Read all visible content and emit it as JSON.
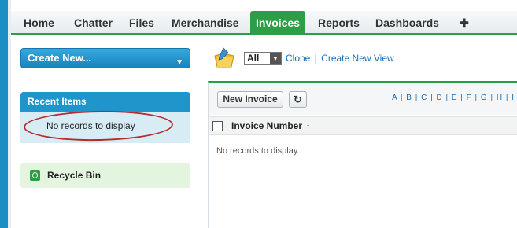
{
  "tabs": [
    "Home",
    "Chatter",
    "Files",
    "Merchandise",
    "Invoices",
    "Reports",
    "Dashboards"
  ],
  "tabs_plus": "✚",
  "active_tab": "Invoices",
  "sidebar": {
    "create_new": "Create New...",
    "caret": "▼",
    "recent_items_title": "Recent Items",
    "recent_empty": "No records to display",
    "recycle_bin": "Recycle Bin"
  },
  "view": {
    "selected": "All",
    "arrow": "▼",
    "clone": "Clone",
    "separator": "|",
    "create_view": "Create New View"
  },
  "list": {
    "new_button": "New Invoice",
    "refresh_icon": "↻",
    "alphabet": "A | B | C | D | E | F | G | H | I",
    "column": "Invoice Number",
    "sort_arrow": "↑",
    "empty": "No records to display."
  },
  "colors": {
    "accent_green": "#2e9e46",
    "accent_blue": "#1f95cc",
    "annotation_red": "#b22c2c"
  },
  "icons": [
    "folder-pencil-icon",
    "refresh-icon",
    "recycle-bin-icon",
    "plus-icon",
    "chevron-down-icon"
  ]
}
